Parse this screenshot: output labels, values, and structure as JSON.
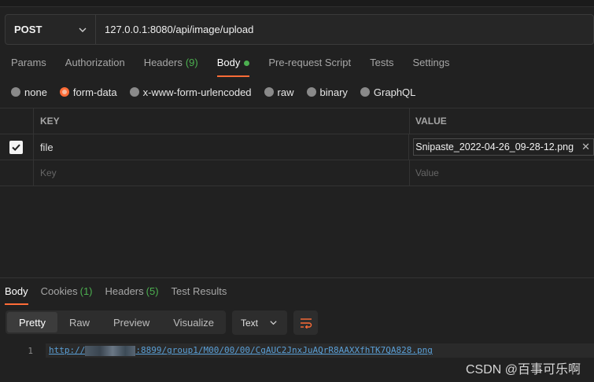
{
  "request": {
    "method": "POST",
    "url": "127.0.0.1:8080/api/image/upload"
  },
  "request_tabs": [
    {
      "label": "Params",
      "count": ""
    },
    {
      "label": "Authorization",
      "count": ""
    },
    {
      "label": "Headers",
      "count": "(9)"
    },
    {
      "label": "Body",
      "count": ""
    },
    {
      "label": "Pre-request Script",
      "count": ""
    },
    {
      "label": "Tests",
      "count": ""
    },
    {
      "label": "Settings",
      "count": ""
    }
  ],
  "active_request_tab": "Body",
  "body_types": [
    "none",
    "form-data",
    "x-www-form-urlencoded",
    "raw",
    "binary",
    "GraphQL"
  ],
  "selected_body_type": "form-data",
  "table": {
    "headers": {
      "key": "KEY",
      "value": "VALUE"
    },
    "rows": [
      {
        "checked": true,
        "key": "file",
        "value": "Snipaste_2022-04-26_09-28-12.png"
      }
    ],
    "placeholders": {
      "key": "Key",
      "value": "Value"
    }
  },
  "response_tabs": [
    {
      "label": "Body",
      "count": ""
    },
    {
      "label": "Cookies",
      "count": "(1)"
    },
    {
      "label": "Headers",
      "count": "(5)"
    },
    {
      "label": "Test Results",
      "count": ""
    }
  ],
  "view_modes": [
    "Pretty",
    "Raw",
    "Preview",
    "Visualize"
  ],
  "active_view": "Pretty",
  "format": "Text",
  "response": {
    "line_number": "1",
    "url_prefix": "http://",
    "url_suffix": ":8899/group1/M00/00/00/CgAUC2JnxJuAQrR8AAXXfhTK7QA828.png"
  },
  "watermark": "CSDN @百事可乐啊",
  "colors": {
    "accent": "#ff6c37",
    "count": "#4caf50",
    "link": "#5a9fd6"
  }
}
